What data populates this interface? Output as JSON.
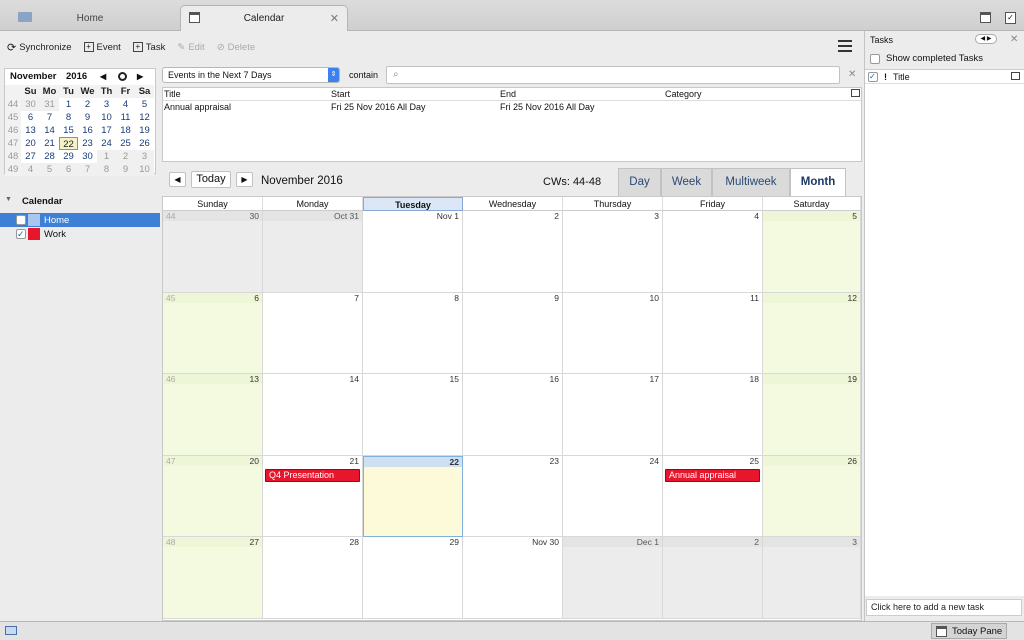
{
  "tabs": [
    {
      "label": "Home"
    },
    {
      "label": "Calendar"
    }
  ],
  "toolbar": {
    "synchronize": "Synchronize",
    "event": "Event",
    "task": "Task",
    "edit": "Edit",
    "delete": "Delete"
  },
  "minimonth": {
    "month": "November",
    "year": "2016",
    "day_headers": [
      "Su",
      "Mo",
      "Tu",
      "We",
      "Th",
      "Fr",
      "Sa"
    ],
    "weeks": [
      {
        "wk": "44",
        "days": [
          "30",
          "31",
          "1",
          "2",
          "3",
          "4",
          "5"
        ]
      },
      {
        "wk": "45",
        "days": [
          "6",
          "7",
          "8",
          "9",
          "10",
          "11",
          "12"
        ]
      },
      {
        "wk": "46",
        "days": [
          "13",
          "14",
          "15",
          "16",
          "17",
          "18",
          "19"
        ]
      },
      {
        "wk": "47",
        "days": [
          "20",
          "21",
          "22",
          "23",
          "24",
          "25",
          "26"
        ]
      },
      {
        "wk": "48",
        "days": [
          "27",
          "28",
          "29",
          "30",
          "1",
          "2",
          "3"
        ]
      },
      {
        "wk": "49",
        "days": [
          "4",
          "5",
          "6",
          "7",
          "8",
          "9",
          "10"
        ]
      }
    ]
  },
  "calendars": {
    "section_label": "Calendar",
    "items": [
      {
        "name": "Home",
        "checked": false,
        "color": "#a9c6ee"
      },
      {
        "name": "Work",
        "checked": true,
        "color": "#e8162c"
      }
    ]
  },
  "filter": {
    "selected": "Events in the Next 7 Days",
    "contain_label": "contain",
    "search_value": ""
  },
  "event_list": {
    "headers": [
      "Title",
      "Start",
      "End",
      "Category"
    ],
    "rows": [
      {
        "title": "Annual appraisal",
        "start": "Fri 25 Nov 2016 All Day",
        "end": "Fri 25 Nov 2016 All Day",
        "category": ""
      }
    ]
  },
  "view": {
    "today_button": "Today",
    "month_label": "November 2016",
    "cw_label": "CWs: 44-48",
    "tabs": [
      "Day",
      "Week",
      "Multiweek",
      "Month"
    ],
    "active_tab": "Month"
  },
  "month_grid": {
    "day_headers": [
      "Sunday",
      "Monday",
      "Tuesday",
      "Wednesday",
      "Thursday",
      "Friday",
      "Saturday"
    ],
    "weeks": [
      {
        "wk": "44",
        "days": [
          "30",
          "Oct 31",
          "Nov 1",
          "2",
          "3",
          "4",
          "5"
        ]
      },
      {
        "wk": "45",
        "days": [
          "6",
          "7",
          "8",
          "9",
          "10",
          "11",
          "12"
        ]
      },
      {
        "wk": "46",
        "days": [
          "13",
          "14",
          "15",
          "16",
          "17",
          "18",
          "19"
        ]
      },
      {
        "wk": "47",
        "days": [
          "20",
          "21",
          "22",
          "23",
          "24",
          "25",
          "26"
        ]
      },
      {
        "wk": "48",
        "days": [
          "27",
          "28",
          "29",
          "Nov 30",
          "Dec 1",
          "2",
          "3"
        ]
      }
    ],
    "events": [
      {
        "week": 3,
        "day": 1,
        "title": "Q4 Presentation"
      },
      {
        "week": 3,
        "day": 5,
        "title": "Annual appraisal"
      }
    ]
  },
  "tasks": {
    "title": "Tasks",
    "show_completed": "Show completed Tasks",
    "column_title": "Title",
    "new_task_placeholder": "Click here to add a new task"
  },
  "statusbar": {
    "today_pane": "Today Pane"
  }
}
